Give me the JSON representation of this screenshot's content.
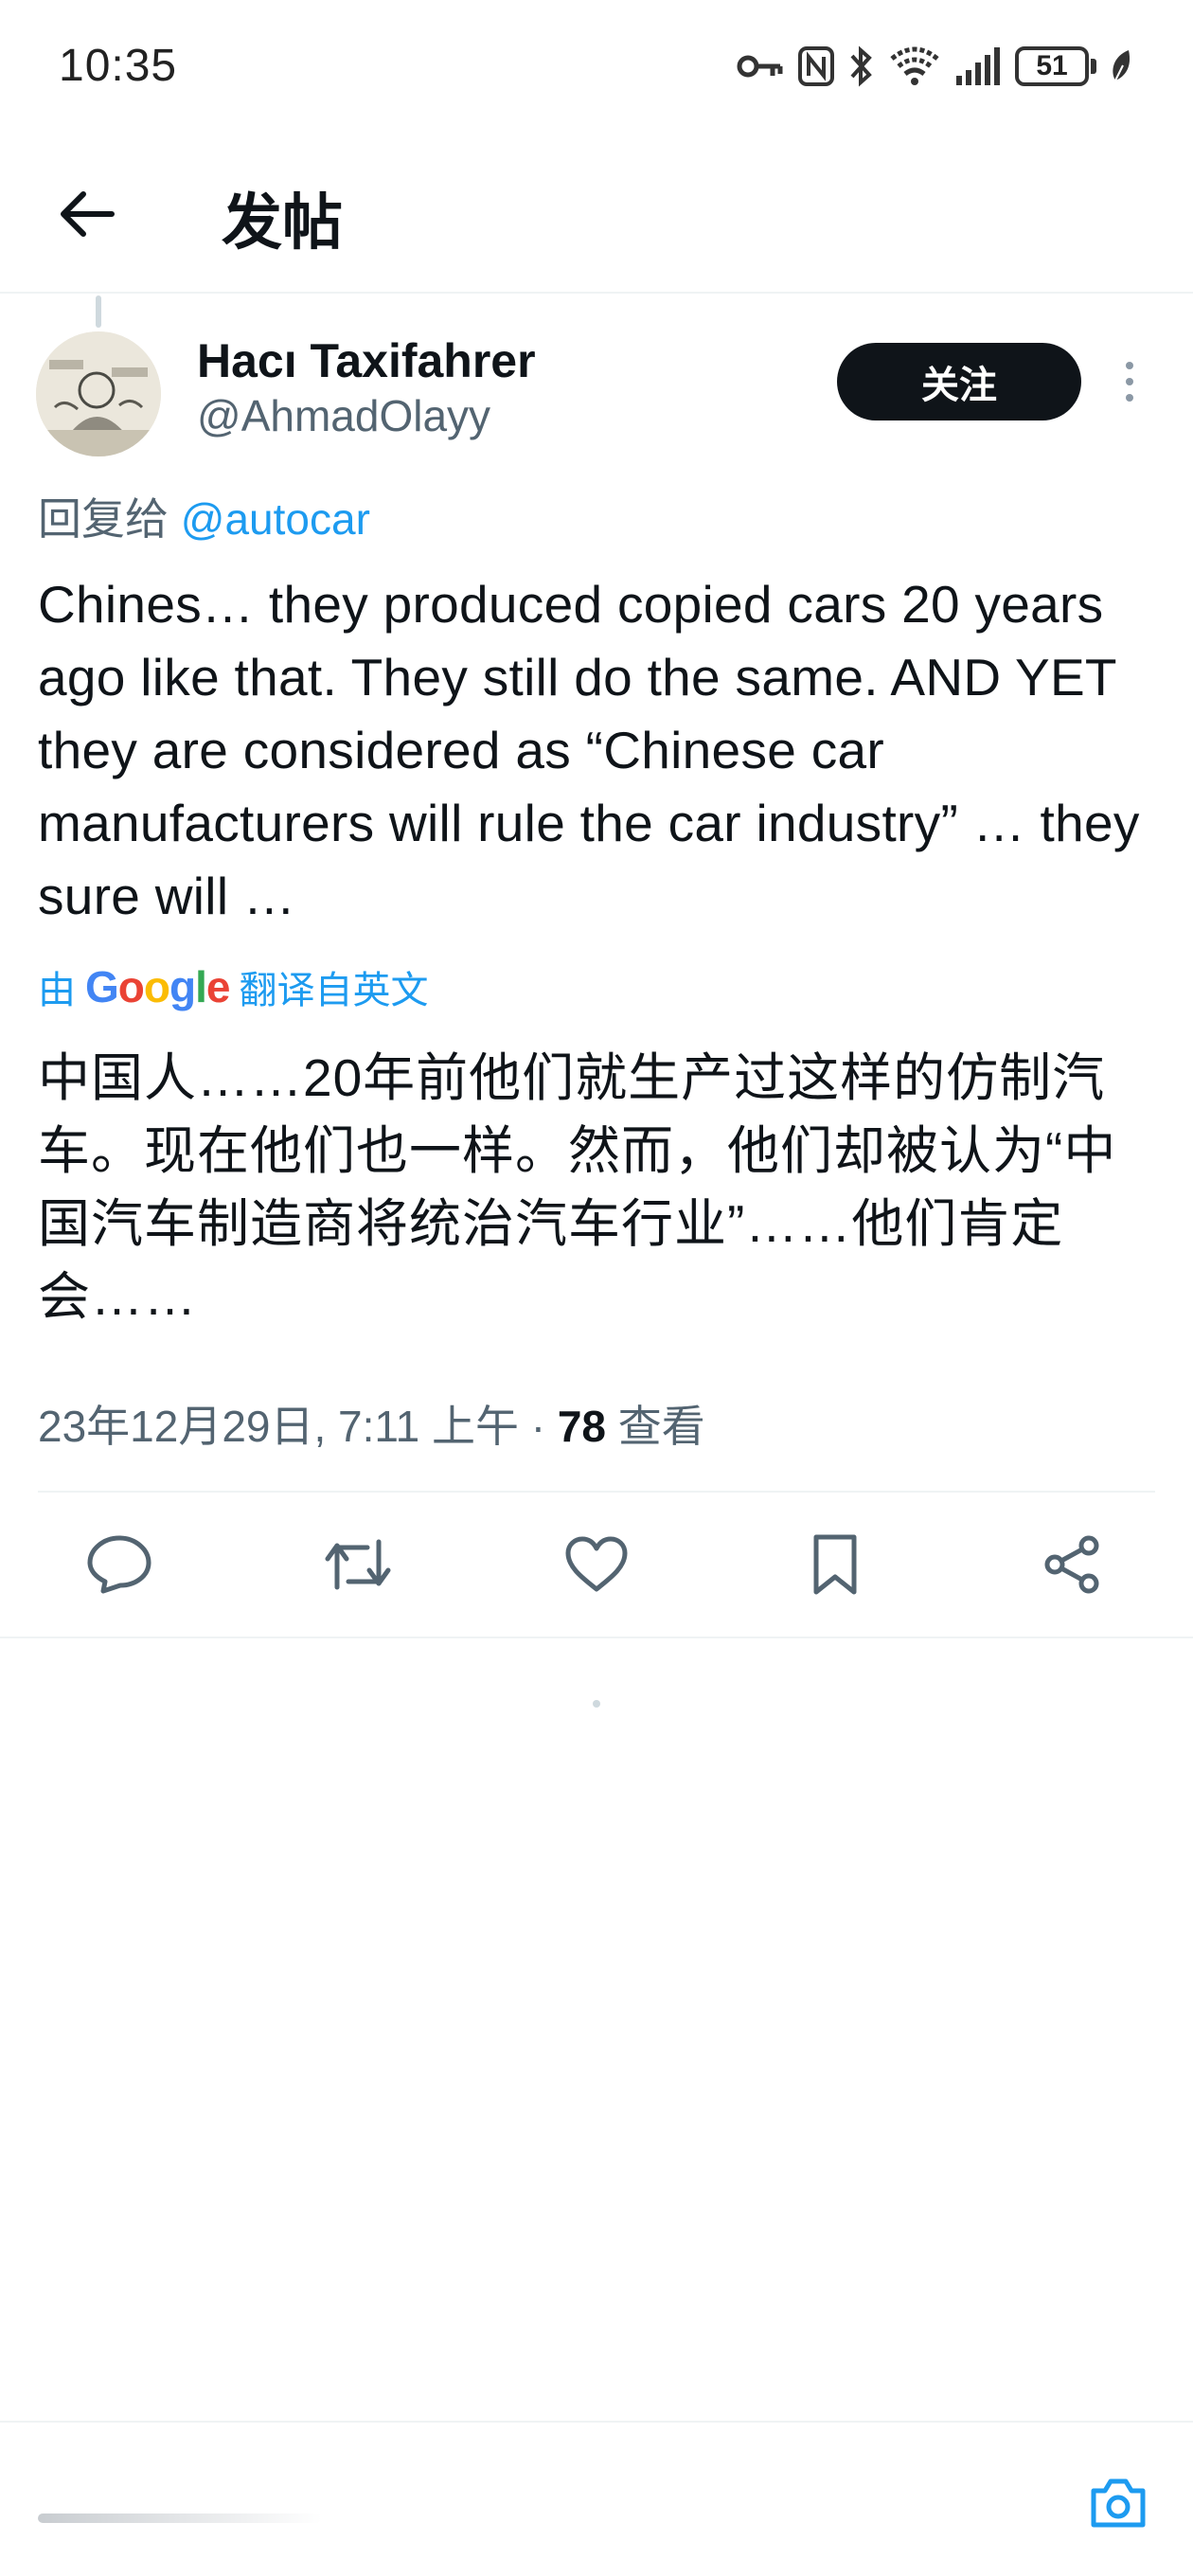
{
  "status_bar": {
    "time": "10:35",
    "battery": "51",
    "icons": [
      "key-icon",
      "nfc-icon",
      "bluetooth-icon",
      "wifi-icon",
      "signal-icon",
      "battery-icon",
      "leaf-icon"
    ]
  },
  "header": {
    "back_icon": "arrow-left-icon",
    "title": "发帖"
  },
  "tweet": {
    "author": {
      "name": "Hacı Taxifahrer",
      "handle": "@AhmadOlayy"
    },
    "follow_label": "关注",
    "reply_prefix": "回复给 ",
    "reply_to": "@autocar",
    "text": "Chines… they produced copied cars 20 years ago like that. They still do the same. AND YET they are considered as “Chinese car manufacturers will rule the car industry” … they sure will …",
    "translated_prefix": "由",
    "translated_suffix": "翻译自英文",
    "translated_text": "中国人……20年前他们就生产过这样的仿制汽车。现在他们也一样。然而，他们却被认为“中国汽车制造商将统治汽车行业”……他们肯定会……",
    "date": "23年12月29日, 7:11 上午 · ",
    "views_count": "78",
    "views_label": " 查看"
  },
  "actions": [
    "reply-icon",
    "retweet-icon",
    "like-icon",
    "bookmark-icon",
    "share-icon"
  ],
  "colors": {
    "accent": "#1d9bf0",
    "text": "#0f1419",
    "secondary": "#536471",
    "follow_button_bg": "#0f1419"
  }
}
